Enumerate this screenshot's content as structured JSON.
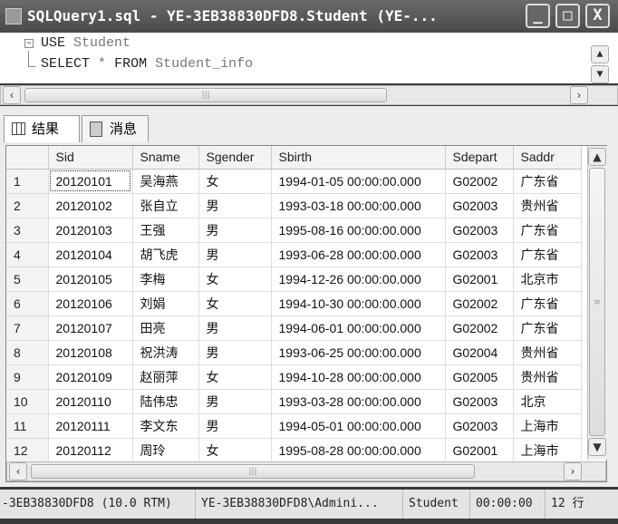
{
  "window": {
    "title": "SQLQuery1.sql - YE-3EB38830DFD8.Student (YE-...",
    "minimize": "_",
    "maximize": "□",
    "close": "X"
  },
  "editor": {
    "lines": [
      "USE Student",
      "SELECT * FROM Student_info"
    ],
    "kw1": "USE",
    "obj1": "Student",
    "kw2": "SELECT",
    "star": "*",
    "kw3": "FROM",
    "obj2": "Student_info"
  },
  "tabs": [
    {
      "label": "结果"
    },
    {
      "label": "消息"
    }
  ],
  "grid": {
    "columns": [
      "Sid",
      "Sname",
      "Sgender",
      "Sbirth",
      "Sdepart",
      "Saddr"
    ],
    "rows": [
      [
        "1",
        "20120101",
        "吴海燕",
        "女",
        "1994-01-05 00:00:00.000",
        "G02002",
        "广东省"
      ],
      [
        "2",
        "20120102",
        "张自立",
        "男",
        "1993-03-18 00:00:00.000",
        "G02003",
        "贵州省"
      ],
      [
        "3",
        "20120103",
        "王强",
        "男",
        "1995-08-16 00:00:00.000",
        "G02003",
        "广东省"
      ],
      [
        "4",
        "20120104",
        "胡飞虎",
        "男",
        "1993-06-28 00:00:00.000",
        "G02003",
        "广东省"
      ],
      [
        "5",
        "20120105",
        "李梅",
        "女",
        "1994-12-26 00:00:00.000",
        "G02001",
        "北京市"
      ],
      [
        "6",
        "20120106",
        "刘娟",
        "女",
        "1994-10-30 00:00:00.000",
        "G02002",
        "广东省"
      ],
      [
        "7",
        "20120107",
        "田亮",
        "男",
        "1994-06-01 00:00:00.000",
        "G02002",
        "广东省"
      ],
      [
        "8",
        "20120108",
        "祝洪涛",
        "男",
        "1993-06-25 00:00:00.000",
        "G02004",
        "贵州省"
      ],
      [
        "9",
        "20120109",
        "赵丽萍",
        "女",
        "1994-10-28 00:00:00.000",
        "G02005",
        "贵州省"
      ],
      [
        "10",
        "20120110",
        "陆伟忠",
        "男",
        "1993-03-28 00:00:00.000",
        "G02003",
        "北京"
      ],
      [
        "11",
        "20120111",
        "李文东",
        "男",
        "1994-05-01 00:00:00.000",
        "G02003",
        "上海市"
      ],
      [
        "12",
        "20120112",
        "周玲",
        "女",
        "1995-08-28 00:00:00.000",
        "G02001",
        "上海市"
      ]
    ]
  },
  "status": {
    "server": "-3EB38830DFD8 (10.0 RTM)",
    "user": "YE-3EB38830DFD8\\Admini...",
    "database": "Student",
    "elapsed": "00:00:00",
    "rows": "12 行"
  }
}
